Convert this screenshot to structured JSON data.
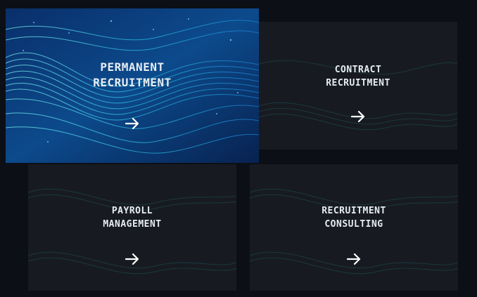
{
  "colors": {
    "page_background": "#0c0f15",
    "card_background": "#161a20",
    "active_card_background": "#0a3a7a",
    "wave_highlight": "#4fd6e8",
    "text": "#e7ecf2"
  },
  "cards": [
    {
      "title_line1": "PERMANENT",
      "title_line2": "RECRUITMENT",
      "icon": "arrow-right-icon",
      "active": true
    },
    {
      "title_line1": "CONTRACT",
      "title_line2": "RECRUITMENT",
      "icon": "arrow-right-icon",
      "active": false
    },
    {
      "title_line1": "PAYROLL",
      "title_line2": "MANAGEMENT",
      "icon": "arrow-right-icon",
      "active": false
    },
    {
      "title_line1": "RECRUITMENT",
      "title_line2": "CONSULTING",
      "icon": "arrow-right-icon",
      "active": false
    }
  ]
}
